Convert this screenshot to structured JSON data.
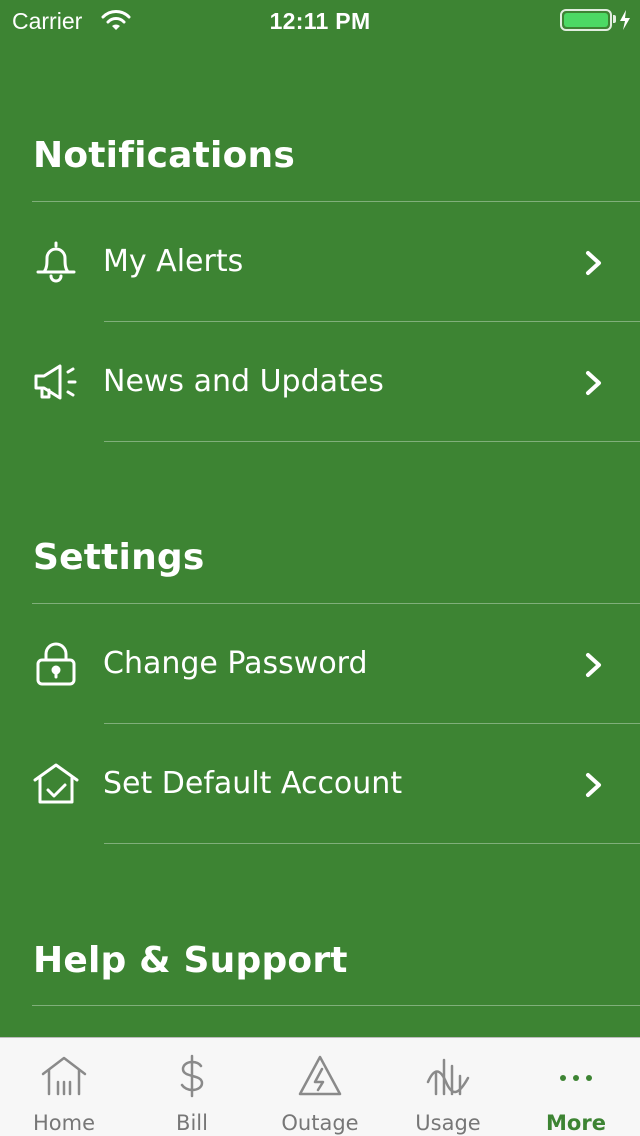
{
  "status_bar": {
    "carrier": "Carrier",
    "time": "12:11 PM",
    "battery_color": "#4cd964"
  },
  "sections": [
    {
      "title": "Notifications",
      "items": [
        {
          "label": "My Alerts",
          "icon": "bell-icon"
        },
        {
          "label": "News and Updates",
          "icon": "megaphone-icon"
        }
      ]
    },
    {
      "title": "Settings",
      "items": [
        {
          "label": "Change Password",
          "icon": "lock-icon"
        },
        {
          "label": "Set Default Account",
          "icon": "house-check-icon"
        }
      ]
    },
    {
      "title": "Help & Support",
      "items": []
    }
  ],
  "tab_bar": {
    "active_color": "#3d8433",
    "tabs": [
      {
        "label": "Home",
        "icon": "home-icon"
      },
      {
        "label": "Bill",
        "icon": "dollar-icon"
      },
      {
        "label": "Outage",
        "icon": "outage-icon"
      },
      {
        "label": "Usage",
        "icon": "usage-icon"
      },
      {
        "label": "More",
        "icon": "more-icon",
        "active": true
      }
    ]
  },
  "theme": {
    "background": "#3d8433"
  }
}
